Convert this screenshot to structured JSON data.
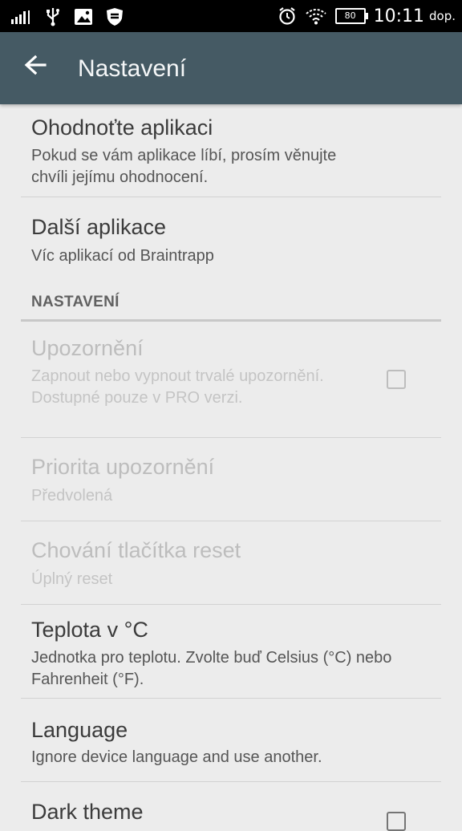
{
  "status_bar": {
    "time": "10:11",
    "ampm": "dop.",
    "battery": "80",
    "icons": [
      "signal-icon",
      "usb-icon",
      "image-icon",
      "shield-icon",
      "alarm-icon",
      "wifi-icon",
      "battery-icon"
    ]
  },
  "app_bar": {
    "title": "Nastavení",
    "background": "#455a64"
  },
  "items": [
    {
      "title": "Ohodnoťte aplikaci",
      "summary": "Pokud se vám aplikace líbí, prosím věnujte chvíli jejímu ohodnocení."
    },
    {
      "title": "Další aplikace",
      "summary": "Víc aplikací od Braintrapp"
    }
  ],
  "category": {
    "label": "NASTAVENÍ"
  },
  "settings": [
    {
      "title": "Upozornění",
      "summary": "Zapnout nebo vypnout trvalé upozornění. Dostupné pouze v PRO verzi.",
      "disabled": true,
      "checked": false
    },
    {
      "title": "Priorita upozornění",
      "summary": "Předvolená",
      "disabled": true
    },
    {
      "title": "Chování tlačítka reset",
      "summary": "Úplný reset",
      "disabled": true
    },
    {
      "title": "Teplota v °C",
      "summary": "Jednotka pro teplotu. Zvolte buď Celsius (°C) nebo Fahrenheit (°F)."
    },
    {
      "title": "Language",
      "summary": "Ignore device language and use another."
    },
    {
      "title": "Dark theme",
      "checked": false
    }
  ]
}
